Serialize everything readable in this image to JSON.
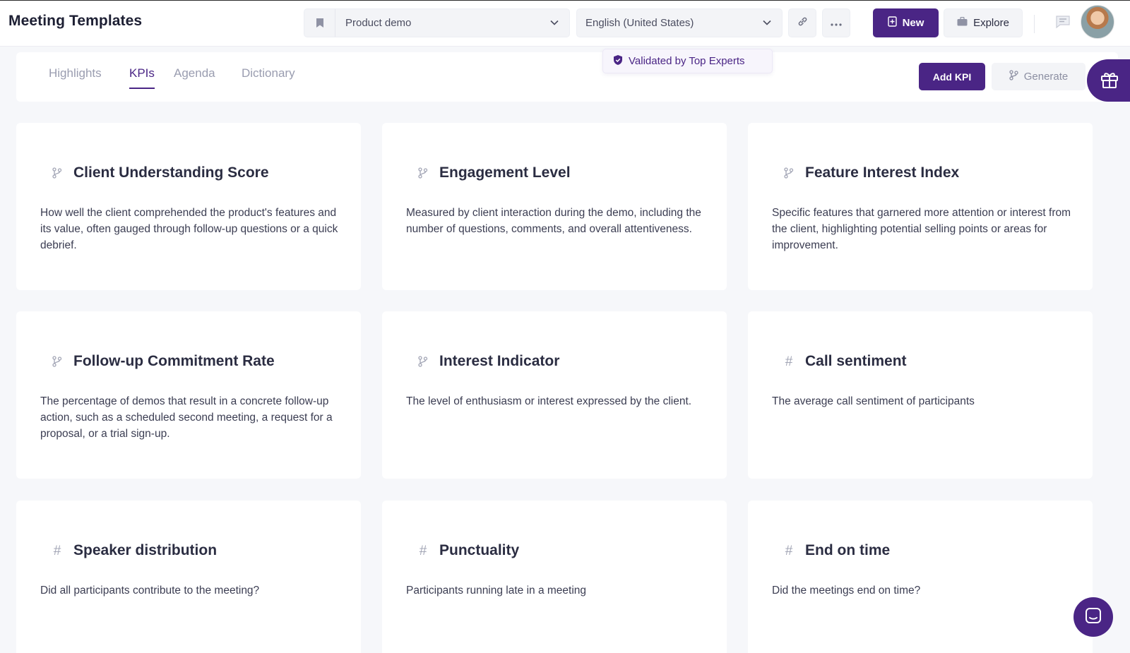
{
  "header": {
    "title": "Meeting Templates",
    "template_select": "Product demo",
    "language_select": "English (United States)",
    "new_label": "New",
    "explore_label": "Explore"
  },
  "tabs": [
    {
      "label": "Highlights",
      "active": false
    },
    {
      "label": "KPIs",
      "active": true
    },
    {
      "label": "Agenda",
      "active": false
    },
    {
      "label": "Dictionary",
      "active": false
    }
  ],
  "validated_badge": "Validated by Top Experts",
  "actions": {
    "add_kpi_label": "Add KPI",
    "generate_label": "Generate"
  },
  "kpis": [
    {
      "icon": "branch-icon",
      "title": "Client Understanding Score",
      "description": "How well the client comprehended the product's features and its value, often gauged through follow-up questions or a quick debrief."
    },
    {
      "icon": "branch-icon",
      "title": "Engagement Level",
      "description": "Measured by client interaction during the demo, including the number of questions, comments, and overall attentiveness."
    },
    {
      "icon": "branch-icon",
      "title": "Feature Interest Index",
      "description": "Specific features that garnered more attention or interest from the client, highlighting potential selling points or areas for improvement."
    },
    {
      "icon": "branch-icon",
      "title": "Follow-up Commitment Rate",
      "description": "The percentage of demos that result in a concrete follow-up action, such as a scheduled second meeting, a request for a proposal, or a trial sign-up."
    },
    {
      "icon": "branch-icon",
      "title": "Interest Indicator",
      "description": "The level of enthusiasm or interest expressed by the client."
    },
    {
      "icon": "hash-icon",
      "title": "Call sentiment",
      "description": "The average call sentiment of participants"
    },
    {
      "icon": "hash-icon",
      "title": "Speaker distribution",
      "description": "Did all participants contribute to the meeting?"
    },
    {
      "icon": "hash-icon",
      "title": "Punctuality",
      "description": "Participants running late in a meeting"
    },
    {
      "icon": "hash-icon",
      "title": "End on time",
      "description": "Did the meetings end on time?"
    }
  ],
  "colors": {
    "accent": "#4a2585",
    "background": "#f6f7fa",
    "card": "#ffffff"
  }
}
